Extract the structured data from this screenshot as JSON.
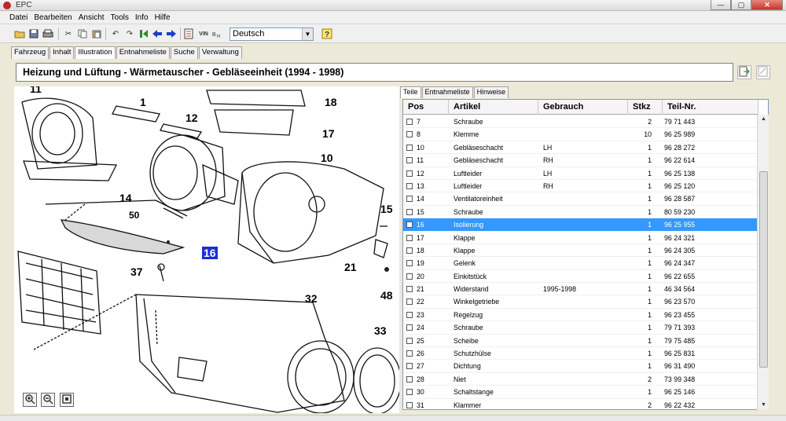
{
  "window": {
    "title": "EPC",
    "min": "—",
    "max": "▢",
    "close": "✕"
  },
  "menu": [
    "Datei",
    "Bearbeiten",
    "Ansicht",
    "Tools",
    "Info",
    "Hilfe"
  ],
  "toolbar": {
    "language": "Deutsch",
    "vin_label": "VIN"
  },
  "tabs": [
    "Fahrzeug",
    "Inhalt",
    "Illustration",
    "Entnahmeliste",
    "Suche",
    "Verwaltung"
  ],
  "active_tab": "Illustration",
  "page_title": "Heizung und Lüftung - Wärmetauscher - Gebläseeinheit   (1994 - 1998)",
  "subtabs": [
    "Teile",
    "Entnahmeliste",
    "Hinweise"
  ],
  "columns": {
    "pos": "Pos",
    "artikel": "Artikel",
    "gebrauch": "Gebrauch",
    "stkz": "Stkz",
    "teil": "Teil-Nr."
  },
  "rows": [
    {
      "pos": "7",
      "artikel": "Schraube",
      "gebrauch": "",
      "stkz": "2",
      "teil": "79 71 443"
    },
    {
      "pos": "8",
      "artikel": "Klemme",
      "gebrauch": "",
      "stkz": "10",
      "teil": "96 25 989"
    },
    {
      "pos": "10",
      "artikel": "Gebläseschacht",
      "gebrauch": "LH",
      "stkz": "1",
      "teil": "96 28 272"
    },
    {
      "pos": "11",
      "artikel": "Gebläseschacht",
      "gebrauch": "RH",
      "stkz": "1",
      "teil": "96 22 614"
    },
    {
      "pos": "12",
      "artikel": "Luftleider",
      "gebrauch": "LH",
      "stkz": "1",
      "teil": "96 25 138"
    },
    {
      "pos": "13",
      "artikel": "Luftleider",
      "gebrauch": "RH",
      "stkz": "1",
      "teil": "96 25 120"
    },
    {
      "pos": "14",
      "artikel": "Ventilatoreinheit",
      "gebrauch": "",
      "stkz": "1",
      "teil": "96 28 587"
    },
    {
      "pos": "15",
      "artikel": "Schraube",
      "gebrauch": "",
      "stkz": "1",
      "teil": "80 59 230"
    },
    {
      "pos": "16",
      "artikel": "Isolierung",
      "gebrauch": "",
      "stkz": "1",
      "teil": "96 25 955",
      "selected": true
    },
    {
      "pos": "17",
      "artikel": "Klappe",
      "gebrauch": "",
      "stkz": "1",
      "teil": "96 24 321"
    },
    {
      "pos": "18",
      "artikel": "Klappe",
      "gebrauch": "",
      "stkz": "1",
      "teil": "96 24 305"
    },
    {
      "pos": "19",
      "artikel": "Gelenk",
      "gebrauch": "",
      "stkz": "1",
      "teil": "96 24 347"
    },
    {
      "pos": "20",
      "artikel": "Einkitstück",
      "gebrauch": "",
      "stkz": "1",
      "teil": "96 22 655"
    },
    {
      "pos": "21",
      "artikel": "Widerstand",
      "gebrauch": "1995-1998",
      "stkz": "1",
      "teil": "46 34 564"
    },
    {
      "pos": "22",
      "artikel": "Winkelgetriebe",
      "gebrauch": "",
      "stkz": "1",
      "teil": "96 23 570"
    },
    {
      "pos": "23",
      "artikel": "Regelzug",
      "gebrauch": "",
      "stkz": "1",
      "teil": "96 23 455"
    },
    {
      "pos": "24",
      "artikel": "Schraube",
      "gebrauch": "",
      "stkz": "1",
      "teil": "79 71 393"
    },
    {
      "pos": "25",
      "artikel": "Scheibe",
      "gebrauch": "",
      "stkz": "1",
      "teil": "79 75 485"
    },
    {
      "pos": "26",
      "artikel": "Schutzhülse",
      "gebrauch": "",
      "stkz": "1",
      "teil": "96 25 831"
    },
    {
      "pos": "27",
      "artikel": "Dichtung",
      "gebrauch": "",
      "stkz": "1",
      "teil": "96 31 490"
    },
    {
      "pos": "28",
      "artikel": "Niet",
      "gebrauch": "",
      "stkz": "2",
      "teil": "73 99 348"
    },
    {
      "pos": "30",
      "artikel": "Schaltstange",
      "gebrauch": "",
      "stkz": "1",
      "teil": "96 25 146"
    },
    {
      "pos": "31",
      "artikel": "Klammer",
      "gebrauch": "",
      "stkz": "2",
      "teil": "96 22 432"
    }
  ],
  "callouts": [
    "11",
    "1",
    "12",
    "18",
    "17",
    "14",
    "10",
    "50",
    "15",
    "16",
    "37",
    "21",
    "48",
    "32",
    "33"
  ],
  "selected_callout": "16",
  "icons": {
    "zoom_in": "zoom-in-icon",
    "zoom_out": "zoom-out-icon",
    "fit": "fit-icon",
    "export": "export-icon",
    "note": "note-icon"
  },
  "colors": {
    "selection": "#3399ff",
    "callout_highlight": "#1a2dd8"
  }
}
